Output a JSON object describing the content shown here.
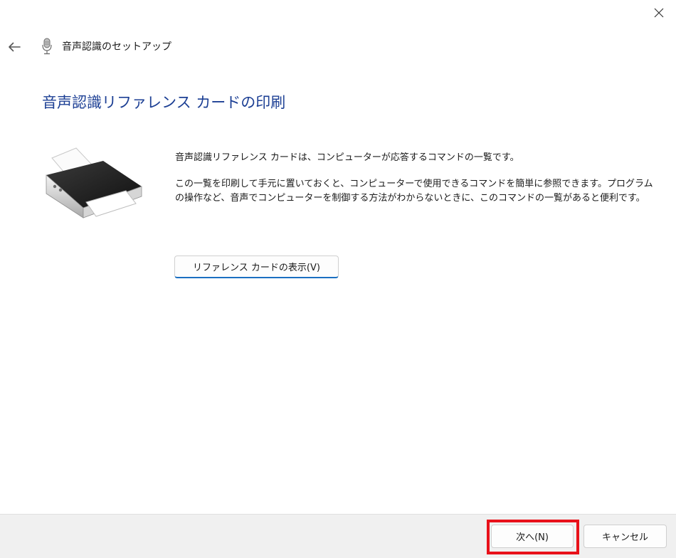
{
  "window": {
    "title": "音声認識のセットアップ",
    "close_icon": "close-icon",
    "back_icon": "back-arrow-icon",
    "app_icon": "microphone-icon"
  },
  "page": {
    "heading": "音声認識リファレンス カードの印刷",
    "heading_color": "#1c3f94",
    "illustration": "printer-icon",
    "paragraphs": [
      "音声認識リファレンス カードは、コンピューターが応答するコマンドの一覧です。",
      "この一覧を印刷して手元に置いておくと、コンピューターで使用できるコマンドを簡単に参照できます。プログラムの操作など、音声でコンピューターを制御する方法がわからないときに、このコマンドの一覧があると便利です。"
    ],
    "show_card_button": "リファレンス カードの表示(V)"
  },
  "footer": {
    "next_button": "次へ(N)",
    "cancel_button": "キャンセル",
    "highlight_color": "#e8111a"
  }
}
